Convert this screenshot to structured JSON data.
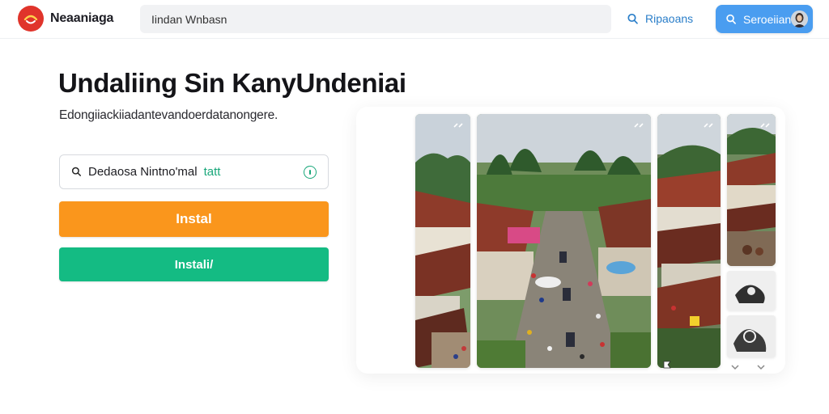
{
  "header": {
    "brand": "Neaaniaga",
    "search_value": "Iindan Wnbasn",
    "link_label": "Ripaoans",
    "button_label": "Seroeiian"
  },
  "hero": {
    "headline": "Undaliing Sin KanyUndeniai",
    "subline": "Edongiiackiiadantevandoerdatanongere.",
    "search_value": "Dedaosa Nintno'mal",
    "search_accent": "tatt",
    "primary_button": "Instal",
    "secondary_button": "Instali/"
  },
  "colors": {
    "brand_red": "#e0342b",
    "link_blue": "#2a7ec9",
    "button_blue": "#4a9df0",
    "orange": "#fa961c",
    "green": "#14bb83"
  },
  "icons": {
    "logo": "brand-logo-icon",
    "header_link": "search-icon",
    "header_button": "search-icon",
    "search_field": "search-icon",
    "search_field_trailing": "info-icon"
  }
}
